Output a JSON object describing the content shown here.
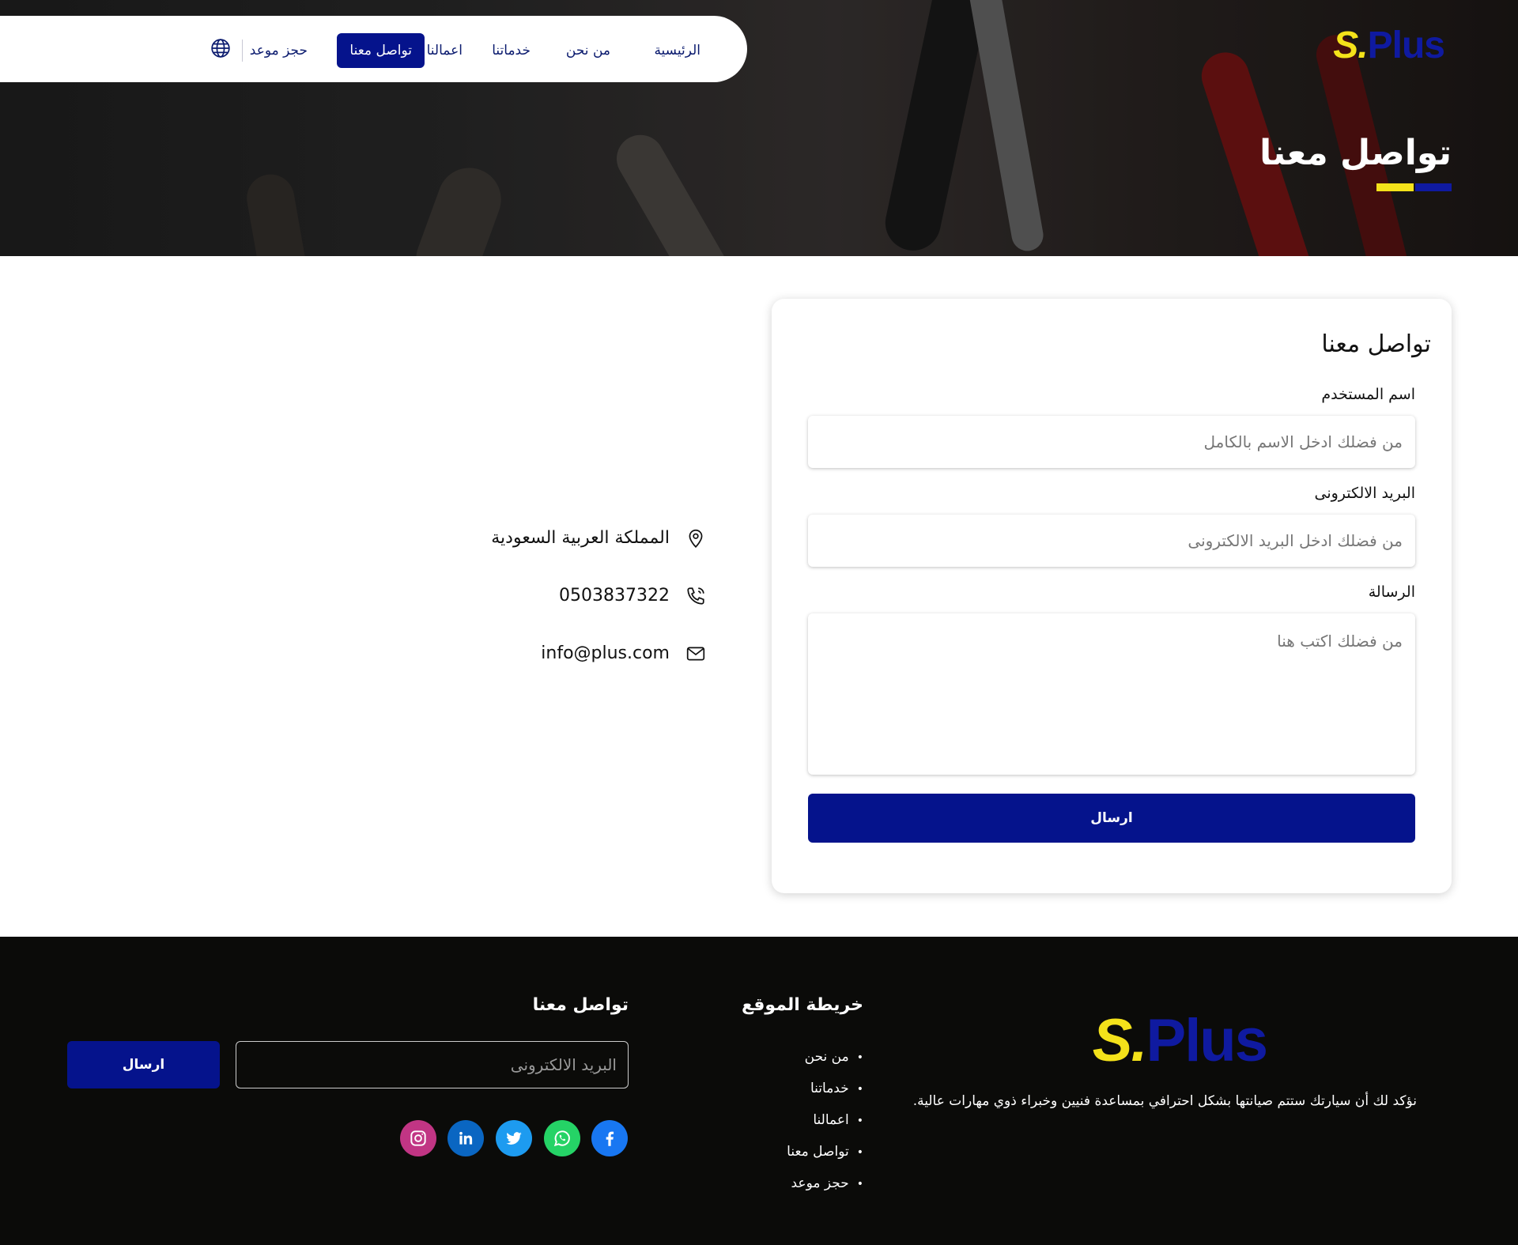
{
  "brand": {
    "logo_s": "S.",
    "logo_plus": "Plus"
  },
  "nav": {
    "items": [
      {
        "label": "الرئيسية"
      },
      {
        "label": "من نحن"
      },
      {
        "label": "خدماتنا"
      },
      {
        "label": "اعمالنا"
      },
      {
        "label": "تواصل معنا",
        "active": true
      },
      {
        "label": "حجز موعد"
      }
    ],
    "language_icon": "globe-icon"
  },
  "hero": {
    "title": "تواصل معنا"
  },
  "form": {
    "title": "تواصل معنا",
    "username_label": "اسم المستخدم",
    "username_placeholder": "من فضلك ادخل الاسم بالكامل",
    "email_label": "البريد الالكترونى",
    "email_placeholder": "من فضلك ادخل البريد الالكترونى",
    "message_label": "الرسالة",
    "message_placeholder": "من فضلك اكتب هنا",
    "submit_label": "ارسال"
  },
  "contact": {
    "address": "المملكة العربية السعودية",
    "phone": "0503837322",
    "email": "info@plus.com"
  },
  "footer": {
    "description": "نؤكد لك أن سيارتك ستتم صيانتها بشكل احترافي بمساعدة فنيين وخبراء ذوي مهارات عالية.",
    "sitemap_title": "خريطة الموقع",
    "sitemap": [
      "من نحن",
      "خدماتنا",
      "اعمالنا",
      "تواصل معنا",
      "حجز موعد"
    ],
    "contact_title": "تواصل معنا",
    "newsletter_placeholder": "البريد الالكترونى",
    "newsletter_button": "ارسال",
    "social": [
      "facebook-icon",
      "whatsapp-icon",
      "twitter-icon",
      "linkedin-icon",
      "instagram-icon"
    ]
  },
  "colors": {
    "primary": "#05138c",
    "accent_yellow": "#f4e21a",
    "footer_bg": "#0b0b09"
  }
}
